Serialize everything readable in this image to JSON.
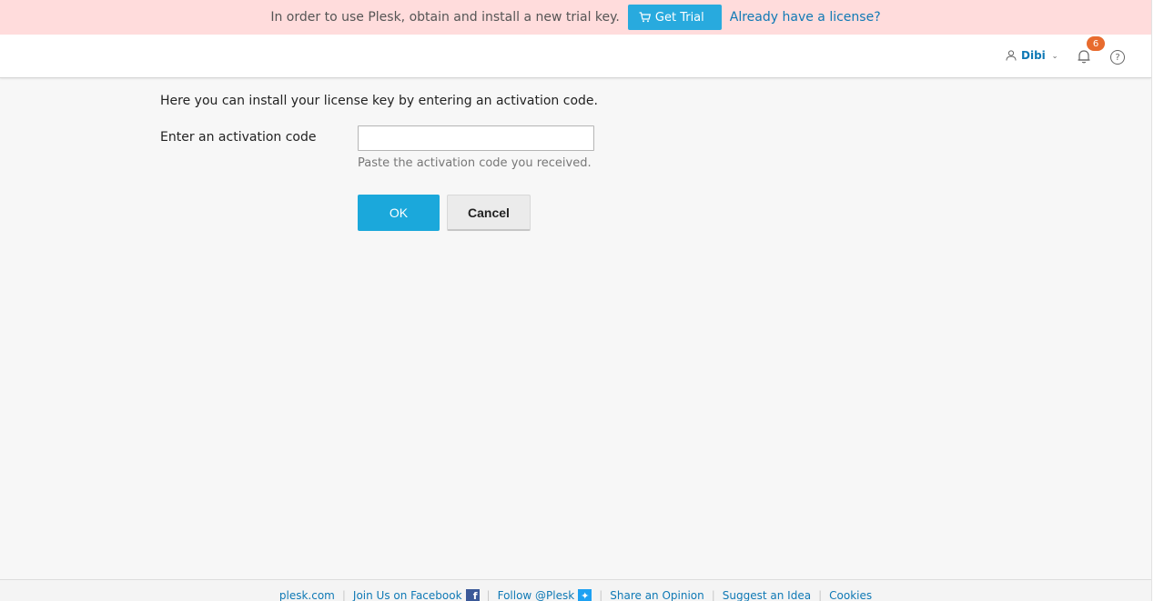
{
  "banner": {
    "text": "In order to use Plesk, obtain and install a new trial key.",
    "get_trial_label": "Get Trial",
    "license_link": "Already have a license?"
  },
  "header": {
    "user_name": "Dibi",
    "notification_count": "6",
    "help_symbol": "?"
  },
  "main": {
    "intro": "Here you can install your license key by entering an activation code.",
    "field_label": "Enter an activation code",
    "field_value": "",
    "hint": "Paste the activation code you received.",
    "ok_label": "OK",
    "cancel_label": "Cancel"
  },
  "footer": {
    "links": [
      "plesk.com",
      "Join Us on Facebook",
      "Follow @Plesk",
      "Share an Opinion",
      "Suggest an Idea",
      "Cookies"
    ]
  },
  "colors": {
    "banner_bg": "#ffdcdc",
    "accent": "#1ba8db",
    "link": "#0f79b5",
    "badge": "#e86b2e"
  },
  "icons": {
    "cart": "cart-icon",
    "user": "user-icon",
    "bell": "bell-icon",
    "help": "help-icon",
    "facebook": "facebook-icon",
    "twitter": "twitter-icon"
  }
}
